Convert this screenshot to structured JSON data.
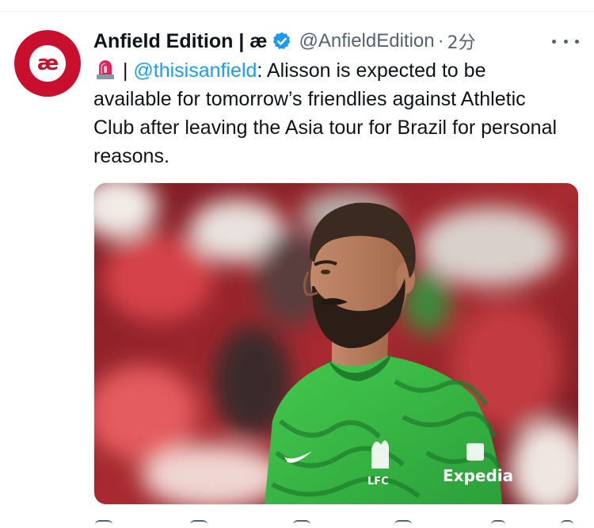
{
  "tweet": {
    "display_name": "Anfield Edition | æ",
    "handle": "@AnfieldEdition",
    "separator": "·",
    "time": "2分",
    "avatar_text": "æ",
    "text_separator": " | ",
    "mention": "@thisisanfield",
    "body_text": ": Alisson is expected to be available for tomorrow’s friendlies against Athletic Club after leaving the Asia tour for Brazil for personal reasons.",
    "siren_icon": "rotating-light-emoji",
    "verified_icon": "verified-badge-icon",
    "more_icon": "more-options-icon"
  },
  "media": {
    "shirt_text": "Expedia",
    "crest_text": "LFC"
  },
  "colors": {
    "brand_red": "#c8102e",
    "link_blue": "#1d9bf0",
    "secondary_text": "#536471",
    "keeper_green": "#3fc24a"
  }
}
